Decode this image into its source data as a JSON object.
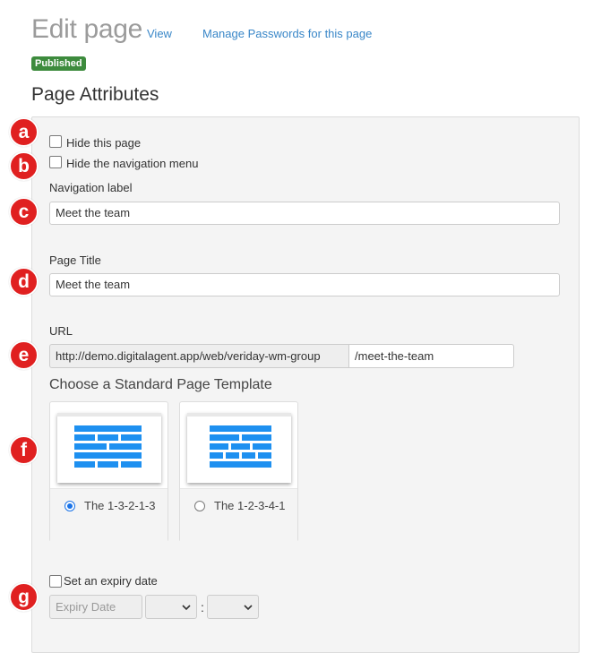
{
  "header": {
    "title": "Edit page",
    "view_link": "View",
    "passwords_link": "Manage Passwords for this page",
    "status_badge": "Published"
  },
  "section_title": "Page Attributes",
  "markers": [
    "a",
    "b",
    "c",
    "d",
    "e",
    "f",
    "g"
  ],
  "form": {
    "hide_page_label": "Hide this page",
    "hide_nav_label": "Hide the navigation menu",
    "hide_page_checked": false,
    "hide_nav_checked": false,
    "nav_label_label": "Navigation label",
    "nav_label_value": "Meet the team",
    "page_title_label": "Page Title",
    "page_title_value": "Meet the team",
    "url_label": "URL",
    "url_prefix": "http://demo.digitalagent.app/web/veriday-wm-group",
    "url_slug": "/meet-the-team",
    "template_heading": "Choose a Standard Page Template",
    "templates": [
      {
        "label": "The 1-3-2-1-3",
        "selected": true
      },
      {
        "label": "The 1-2-3-4-1",
        "selected": false
      }
    ],
    "expiry_label": "Set an expiry date",
    "expiry_checked": false,
    "expiry_placeholder": "Expiry Date",
    "time_separator": ":"
  },
  "colors": {
    "marker": "#e02020",
    "badge": "#3d8b3d",
    "link": "#3a87c8",
    "brick": "#1e90f0"
  }
}
